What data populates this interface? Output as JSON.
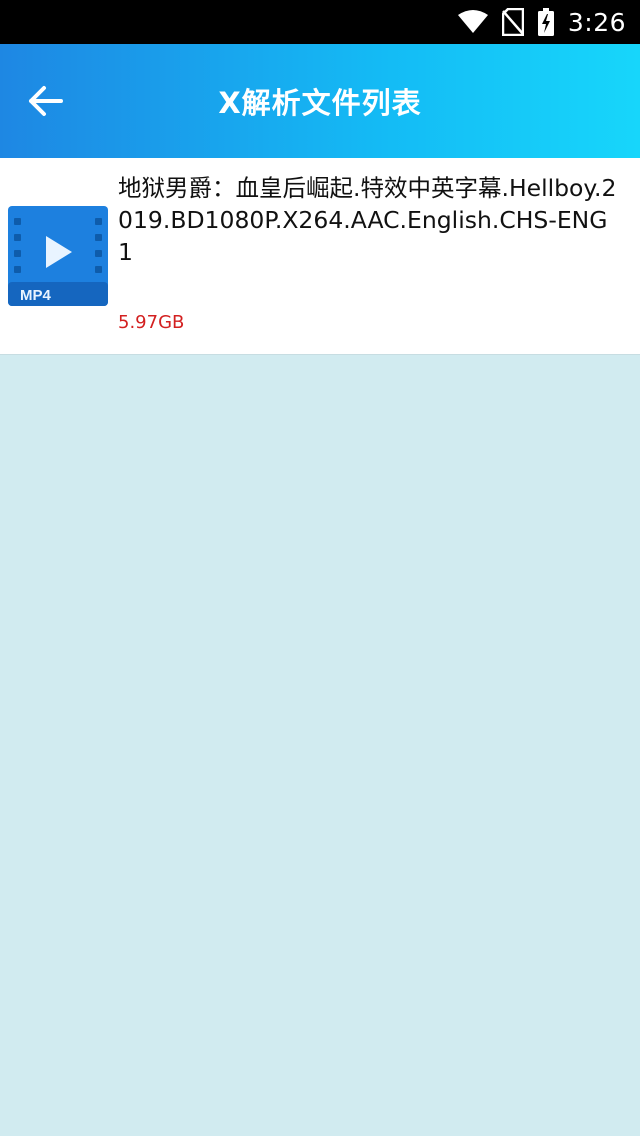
{
  "status_bar": {
    "time": "3:26",
    "icons": [
      "wifi-icon",
      "no-sim-icon",
      "battery-charging-icon"
    ]
  },
  "app_bar": {
    "title": "X解析文件列表",
    "back_icon": "arrow-left-icon"
  },
  "files": [
    {
      "name": "地狱男爵：血皇后崛起.特效中英字幕.Hellboy.2019.BD1080P.X264.AAC.English.CHS-ENG1",
      "size": "5.97GB",
      "badge": "MP4",
      "icon": "video-file-icon"
    }
  ],
  "colors": {
    "app_bar_start": "#1e87e3",
    "app_bar_end": "#17d6fb",
    "background": "#d1ebf0",
    "size_text": "#d32020",
    "thumb_blue": "#1d80df"
  }
}
